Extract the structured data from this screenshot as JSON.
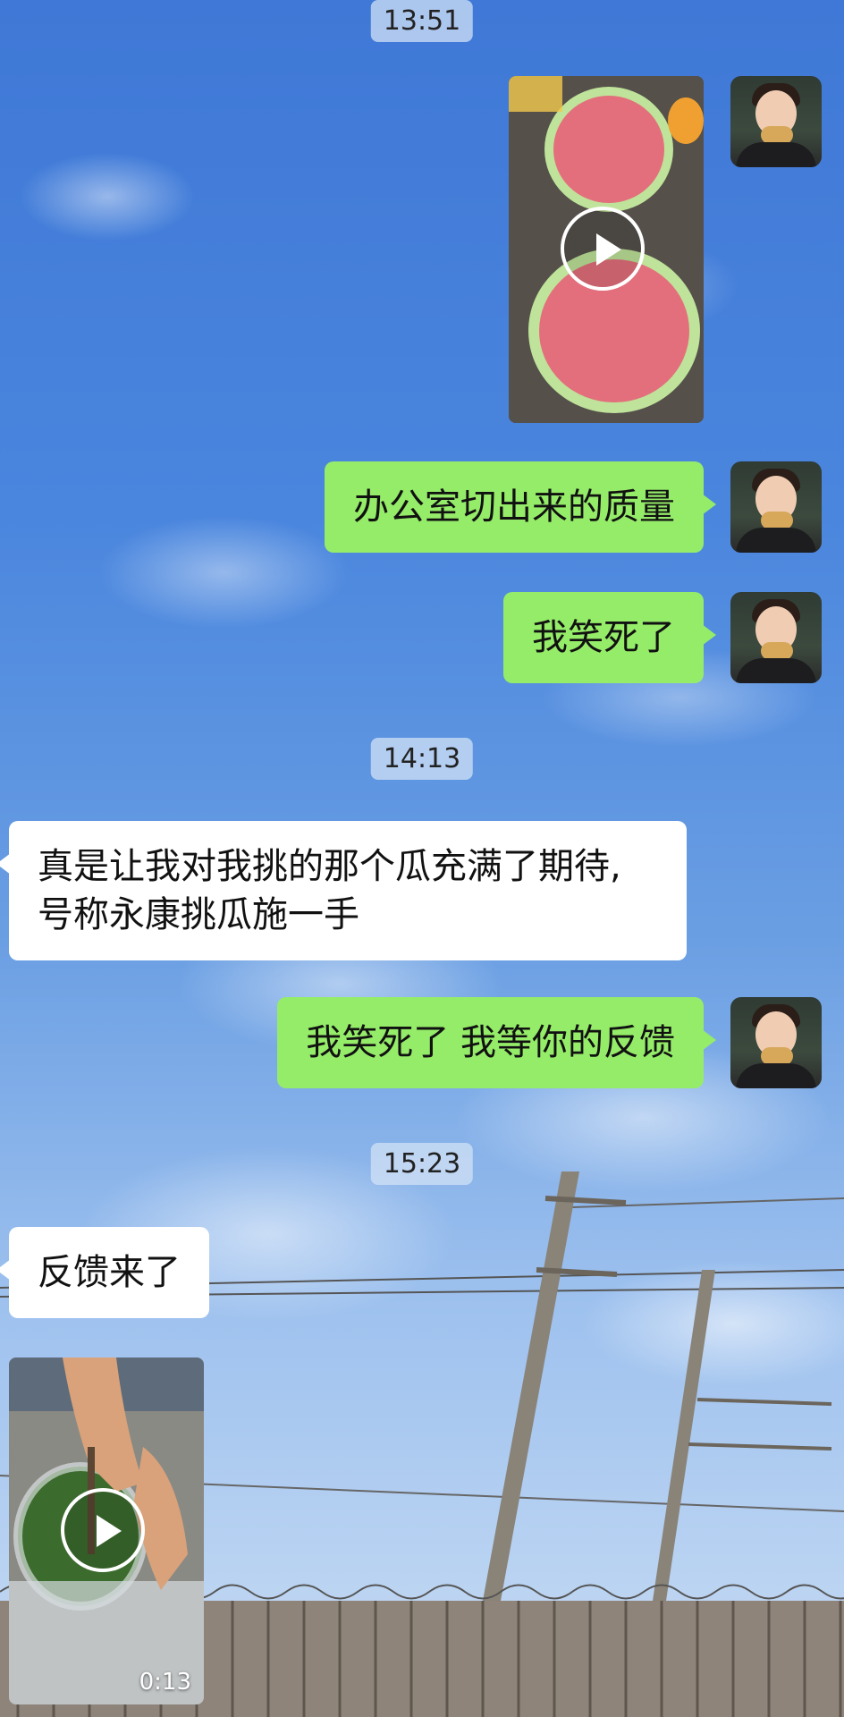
{
  "chat": {
    "timestamps": [
      "13:51",
      "14:13",
      "15:23"
    ],
    "messages": [
      {
        "side": "sent",
        "type": "video",
        "thumbnail": "watermelon-halves-cut"
      },
      {
        "side": "sent",
        "type": "text",
        "text": "办公室切出来的质量"
      },
      {
        "side": "sent",
        "type": "text",
        "text": "我笑死了"
      },
      {
        "side": "received",
        "type": "text",
        "lines": [
          "真是让我对我挑的那个瓜充满了期待,",
          "号称永康挑瓜施一手"
        ]
      },
      {
        "side": "sent",
        "type": "text",
        "text": "我笑死了  我等你的反馈"
      },
      {
        "side": "received",
        "type": "text",
        "text": "反馈来了"
      },
      {
        "side": "received",
        "type": "video",
        "thumbnail": "cutting-whole-watermelon",
        "duration": "0:13"
      }
    ]
  },
  "icons": {
    "play": "play-icon",
    "avatar": "user-avatar-photo"
  },
  "colors": {
    "sent_bubble": "#95ec69",
    "received_bubble": "#ffffff",
    "timestamp_bg": "#d2e1f5",
    "background_sky": "#4a86de"
  }
}
